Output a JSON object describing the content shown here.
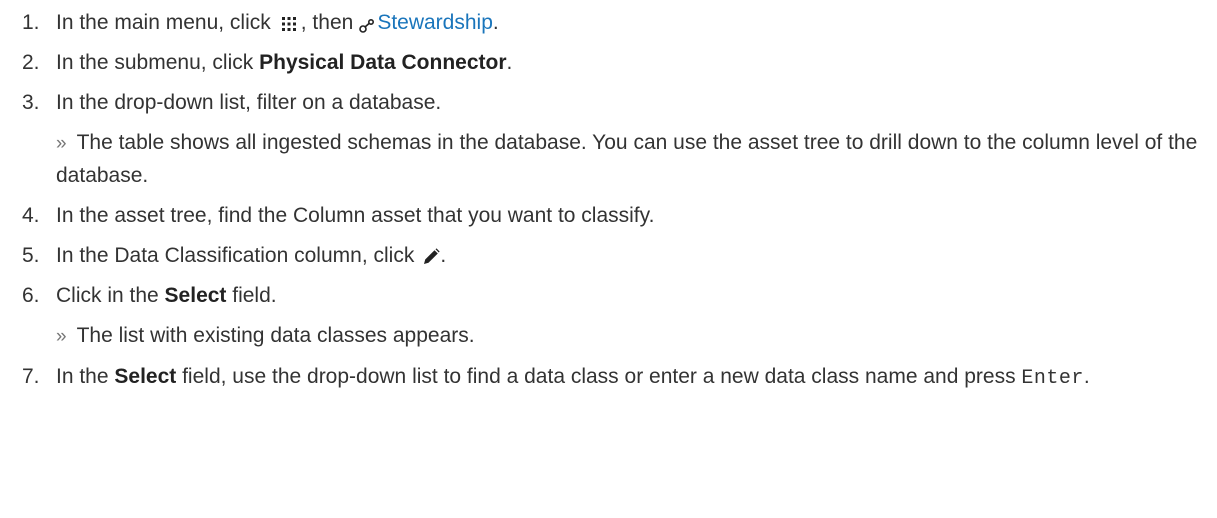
{
  "steps": [
    {
      "number": "1.",
      "text_before": "In the main menu, click",
      "icon_name": "app-grid-icon",
      "text_middle": ", then",
      "link_icon": "stewardship-icon",
      "link_text": "Stewardship",
      "text_after": "."
    },
    {
      "number": "2.",
      "text_before": "In the submenu, click ",
      "bold": "Physical Data Connector",
      "text_after": "."
    },
    {
      "number": "3.",
      "text": "In the drop-down list, filter on a database.",
      "result_marker": "»",
      "result": "The table shows all ingested schemas in the database. You can use the asset tree to drill down to the column level of the database."
    },
    {
      "number": "4.",
      "text": "In the asset tree, find the Column asset that you want to classify."
    },
    {
      "number": "5.",
      "text_before": "In the Data Classification column, click",
      "icon_name": "pencil-icon",
      "text_after": "."
    },
    {
      "number": "6.",
      "text_before": "Click in the ",
      "bold": "Select",
      "text_after": " field.",
      "result_marker": "»",
      "result": "The list with existing data classes appears."
    },
    {
      "number": "7.",
      "text_before": "In the ",
      "bold": "Select",
      "text_middle": " field, use the drop-down list to find a data class or enter a new data class name and press ",
      "code": "Enter",
      "text_after": "."
    }
  ],
  "colors": {
    "text": "#333333",
    "link": "#1a75bb",
    "marker": "#777777"
  }
}
